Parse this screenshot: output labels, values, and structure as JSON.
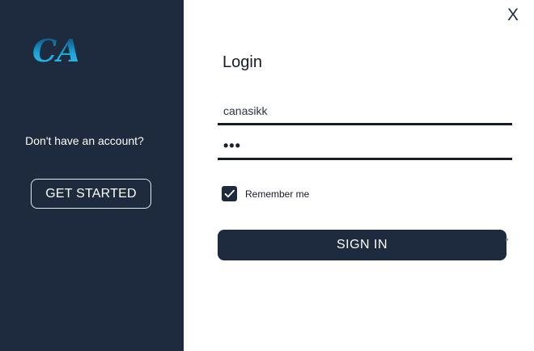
{
  "left_panel": {
    "logo_text": "CA",
    "prompt": "Don't have an account?",
    "get_started_label": "GET STARTED",
    "bg_color": "#1e2a3d"
  },
  "window": {
    "close_label": "X"
  },
  "login": {
    "title": "Login",
    "username_value": "canasikk",
    "password_mask": "•••",
    "remember_label": "Remember me",
    "remember_checked": true,
    "signin_label": "SIGN IN"
  },
  "colors": {
    "accent": "#1e2a3d",
    "logo_gradient_start": "#0a7fb0",
    "logo_gradient_end": "#36c5f0"
  }
}
